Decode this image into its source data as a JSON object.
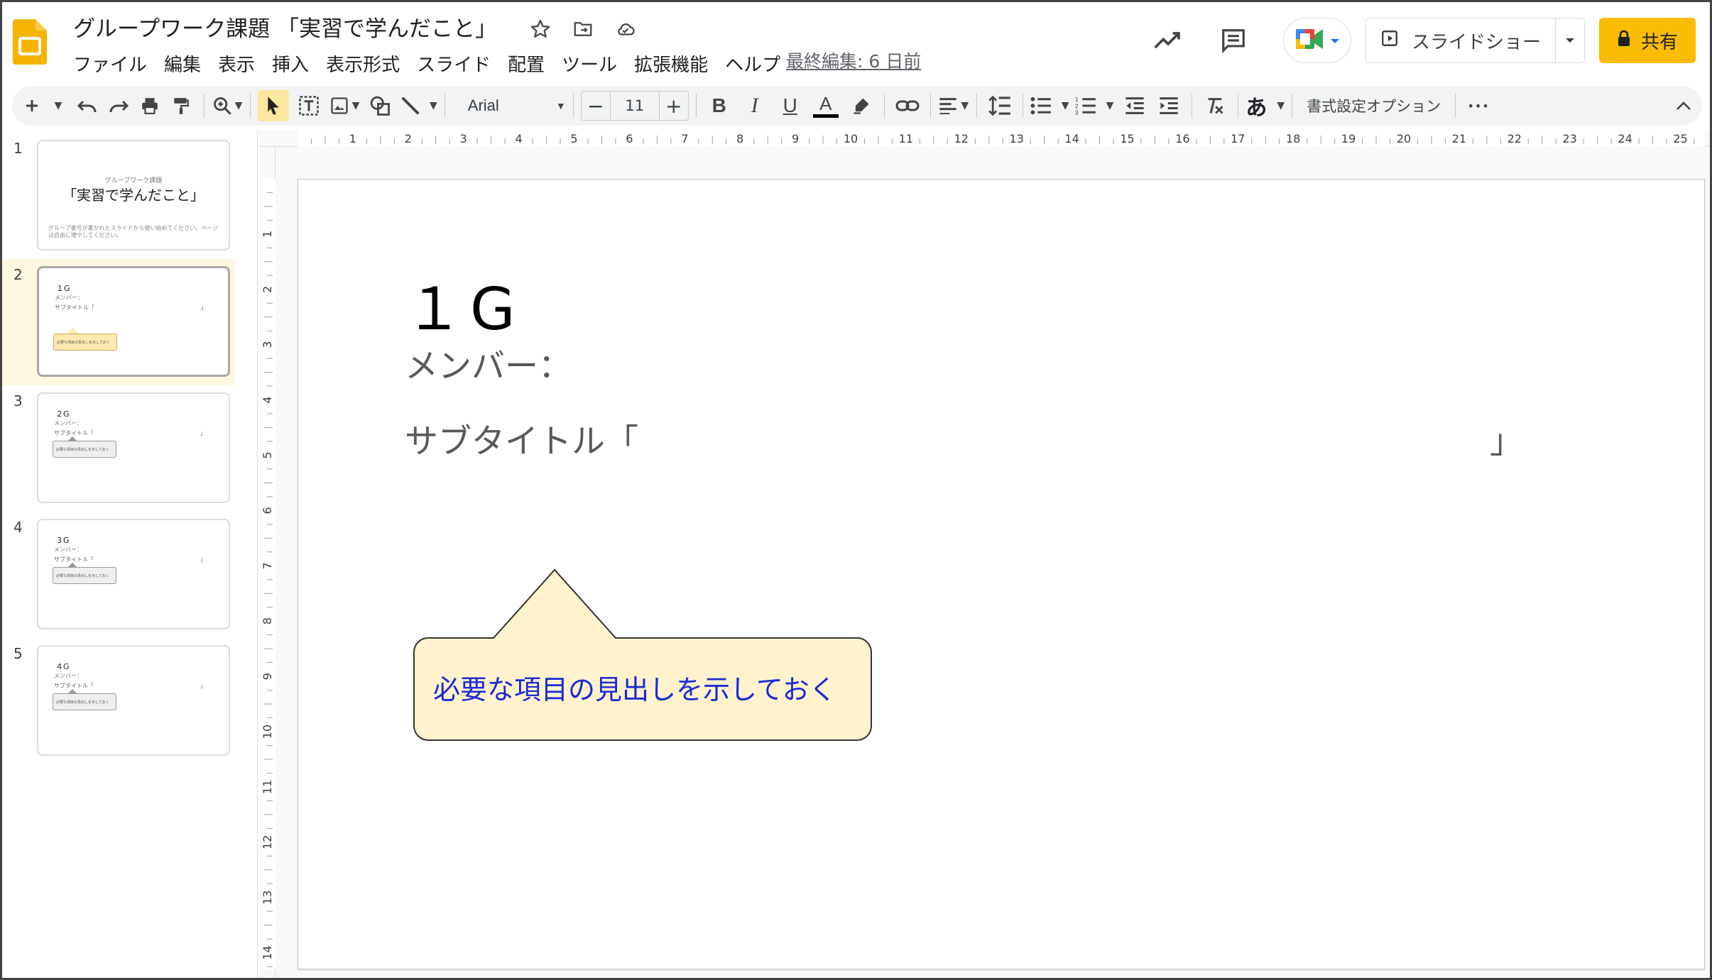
{
  "header": {
    "doc_title": "グループワーク課題 「実習で学んだこと」",
    "last_edit": "最終編集: 6 日前",
    "menu": [
      "ファイル",
      "編集",
      "表示",
      "挿入",
      "表示形式",
      "スライド",
      "配置",
      "ツール",
      "拡張機能",
      "ヘルプ"
    ],
    "slideshow_label": "スライドショー",
    "share_label": "共有"
  },
  "toolbar": {
    "font": "Arial",
    "font_size": "11",
    "bold": "B",
    "italic": "I",
    "underline": "U",
    "text_color": "A",
    "input_tools": "あ",
    "format_options": "書式設定オプション",
    "more": "•••"
  },
  "ruler": {
    "h_ticks": [
      "1",
      "2",
      "3",
      "4",
      "5",
      "6",
      "7",
      "8",
      "9",
      "10",
      "11",
      "12",
      "13",
      "14",
      "15",
      "16",
      "17",
      "18",
      "19",
      "20",
      "21",
      "22",
      "23",
      "24",
      "25"
    ],
    "v_ticks": [
      "1",
      "2",
      "3",
      "4",
      "5",
      "6",
      "7",
      "8",
      "9",
      "10",
      "11",
      "12",
      "13",
      "14"
    ]
  },
  "filmstrip": {
    "slides": [
      {
        "num": "1",
        "sub": "グループワーク課題",
        "title": "「実習で学んだこと」",
        "small": "グループ番号が書かれたスライドから使い始めてください。ページは自由に増やしてください。"
      },
      {
        "num": "2",
        "g": "１G",
        "mem": "メンバー：",
        "sub2": "サブタイトル「",
        "end": "」",
        "bubble": "必要な項目の見出しを示しておく"
      },
      {
        "num": "3",
        "g": "２G",
        "mem": "メンバー：",
        "sub2": "サブタイトル「",
        "end": "」",
        "bubble": "必要な項目の見出しを示しておく"
      },
      {
        "num": "4",
        "g": "３G",
        "mem": "メンバー：",
        "sub2": "サブタイトル「",
        "end": "」",
        "bubble": "必要な項目の見出しを示しておく"
      },
      {
        "num": "5",
        "g": "４G",
        "mem": "メンバー：",
        "sub2": "サブタイトル「",
        "end": "」",
        "bubble": "必要な項目の見出しを示しておく"
      }
    ]
  },
  "slide": {
    "title": "１G",
    "member": "メンバー：",
    "subtitle": "サブタイトル「",
    "subtitle_end": "」",
    "callout": "必要な項目の見出しを示しておく"
  },
  "colors": {
    "accent": "#fbbc04",
    "callout_fill": "#fff2cc",
    "callout_text": "#1a2bd6",
    "selected_slide_bg": "#fef7e0"
  },
  "icons": [
    "slides-logo-icon",
    "star-icon",
    "move-folder-icon",
    "cloud-saved-icon",
    "activity-icon",
    "comment-icon",
    "meet-icon",
    "present-icon",
    "lock-icon",
    "add-icon",
    "undo-icon",
    "redo-icon",
    "print-icon",
    "paint-format-icon",
    "zoom-icon",
    "select-icon",
    "textbox-icon",
    "image-icon",
    "shape-icon",
    "line-icon",
    "link-icon",
    "align-icon",
    "line-spacing-icon",
    "bullet-list-icon",
    "numbered-list-icon",
    "indent-decrease-icon",
    "indent-increase-icon",
    "clear-format-icon",
    "collapse-icon"
  ]
}
